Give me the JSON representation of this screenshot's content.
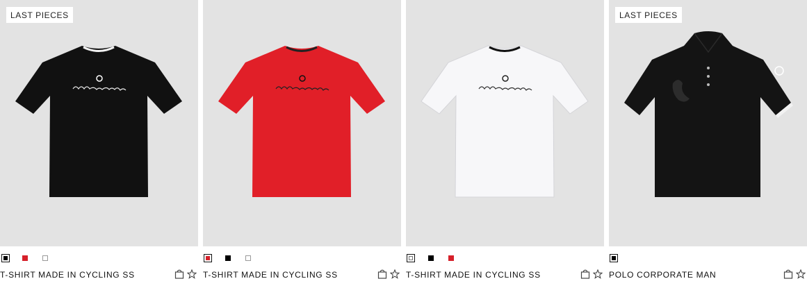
{
  "colors": {
    "black": "#000000",
    "red": "#d6202a",
    "white": "#ffffff",
    "image_bg": "#e3e3e3"
  },
  "products": [
    {
      "badge": "LAST PIECES",
      "name": "T-SHIRT MADE IN CYCLING SS",
      "shirt_color": "black",
      "swatches": [
        "black",
        "red",
        "white"
      ],
      "selected_swatch": "black",
      "actions": [
        "bag-icon",
        "star-icon"
      ]
    },
    {
      "badge": "",
      "name": "T-SHIRT MADE IN CYCLING SS",
      "shirt_color": "red",
      "swatches": [
        "red",
        "black",
        "white"
      ],
      "selected_swatch": "red",
      "actions": [
        "bag-icon",
        "star-icon"
      ]
    },
    {
      "badge": "",
      "name": "T-SHIRT MADE IN CYCLING SS",
      "shirt_color": "white",
      "swatches": [
        "white",
        "black",
        "red"
      ],
      "selected_swatch": "white",
      "actions": [
        "bag-icon",
        "star-icon"
      ]
    },
    {
      "badge": "LAST PIECES",
      "name": "POLO CORPORATE MAN",
      "shirt_color": "black",
      "swatches": [
        "black"
      ],
      "selected_swatch": "black",
      "actions": [
        "bag-icon",
        "star-icon"
      ]
    }
  ]
}
